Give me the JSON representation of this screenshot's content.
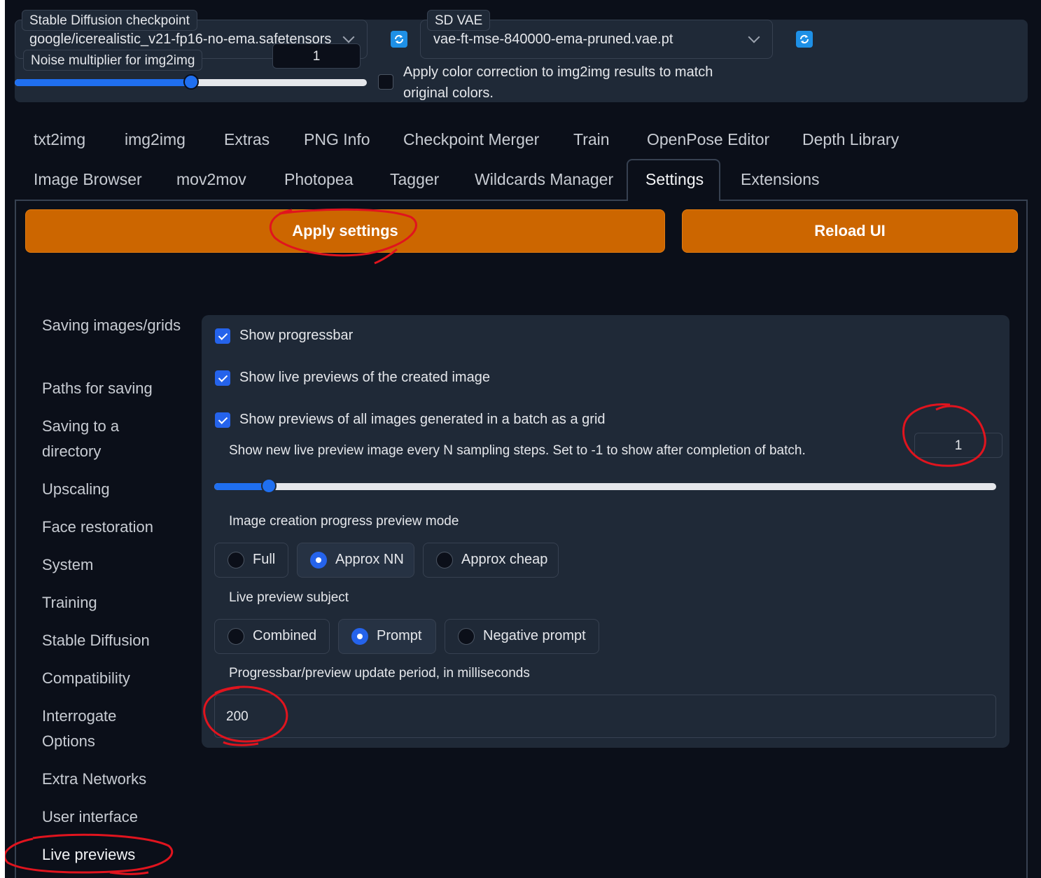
{
  "top": {
    "checkpoint_label": "Stable Diffusion checkpoint",
    "checkpoint_value": "google/icerealistic_v21-fp16-no-ema.safetensors",
    "vae_label": "SD VAE",
    "vae_value": "vae-ft-mse-840000-ema-pruned.vae.pt",
    "noise_label": "Noise multiplier for img2img",
    "noise_value": "1",
    "noise_fraction": 0.5,
    "color_correction_line1": "Apply color correction to img2img results to match",
    "color_correction_line2": "original colors."
  },
  "tabs_row1": [
    "txt2img",
    "img2img",
    "Extras",
    "PNG Info",
    "Checkpoint Merger",
    "Train",
    "OpenPose Editor",
    "Depth Library"
  ],
  "tabs_row2": [
    "Image Browser",
    "mov2mov",
    "Photopea",
    "Tagger",
    "Wildcards Manager",
    "Settings",
    "Extensions"
  ],
  "active_tab": "Settings",
  "buttons": {
    "apply": "Apply settings",
    "reload": "Reload UI"
  },
  "sidebar": [
    "Saving images/grids",
    "Paths for saving",
    "Saving to a directory",
    "Upscaling",
    "Face restoration",
    "System",
    "Training",
    "Stable Diffusion",
    "Compatibility",
    "Interrogate Options",
    "Extra Networks",
    "User interface",
    "Live previews"
  ],
  "settings": {
    "show_progressbar": "Show progressbar",
    "show_live_previews": "Show live previews of the created image",
    "show_batch_grid": "Show previews of all images generated in a batch as a grid",
    "every_n_label": "Show new live preview image every N sampling steps. Set to -1 to show after completion of batch.",
    "every_n_value": "1",
    "every_n_fraction": 0.07,
    "preview_mode_label": "Image creation progress preview mode",
    "preview_mode_options": [
      "Full",
      "Approx NN",
      "Approx cheap"
    ],
    "preview_mode_selected": "Approx NN",
    "subject_label": "Live preview subject",
    "subject_options": [
      "Combined",
      "Prompt",
      "Negative prompt"
    ],
    "subject_selected": "Prompt",
    "period_label": "Progressbar/preview update period, in milliseconds",
    "period_value": "200"
  },
  "colors": {
    "background": "#0b0f19",
    "panel": "#1f2937",
    "accent": "#2563eb",
    "button_orange": "#cc6600",
    "annotation_red": "#e0141e"
  }
}
